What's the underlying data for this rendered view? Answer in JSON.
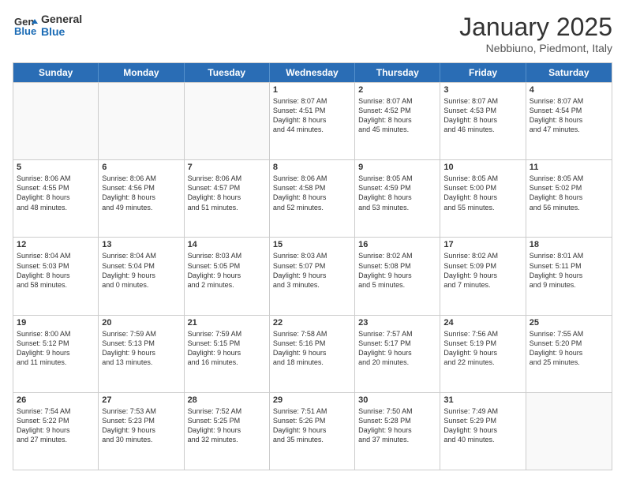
{
  "logo": {
    "line1": "General",
    "line2": "Blue"
  },
  "title": "January 2025",
  "subtitle": "Nebbiuno, Piedmont, Italy",
  "days": [
    "Sunday",
    "Monday",
    "Tuesday",
    "Wednesday",
    "Thursday",
    "Friday",
    "Saturday"
  ],
  "weeks": [
    [
      {
        "day": "",
        "empty": true
      },
      {
        "day": "",
        "empty": true
      },
      {
        "day": "",
        "empty": true
      },
      {
        "day": "1",
        "text": "Sunrise: 8:07 AM\nSunset: 4:51 PM\nDaylight: 8 hours\nand 44 minutes."
      },
      {
        "day": "2",
        "text": "Sunrise: 8:07 AM\nSunset: 4:52 PM\nDaylight: 8 hours\nand 45 minutes."
      },
      {
        "day": "3",
        "text": "Sunrise: 8:07 AM\nSunset: 4:53 PM\nDaylight: 8 hours\nand 46 minutes."
      },
      {
        "day": "4",
        "text": "Sunrise: 8:07 AM\nSunset: 4:54 PM\nDaylight: 8 hours\nand 47 minutes."
      }
    ],
    [
      {
        "day": "5",
        "text": "Sunrise: 8:06 AM\nSunset: 4:55 PM\nDaylight: 8 hours\nand 48 minutes."
      },
      {
        "day": "6",
        "text": "Sunrise: 8:06 AM\nSunset: 4:56 PM\nDaylight: 8 hours\nand 49 minutes."
      },
      {
        "day": "7",
        "text": "Sunrise: 8:06 AM\nSunset: 4:57 PM\nDaylight: 8 hours\nand 51 minutes."
      },
      {
        "day": "8",
        "text": "Sunrise: 8:06 AM\nSunset: 4:58 PM\nDaylight: 8 hours\nand 52 minutes."
      },
      {
        "day": "9",
        "text": "Sunrise: 8:05 AM\nSunset: 4:59 PM\nDaylight: 8 hours\nand 53 minutes."
      },
      {
        "day": "10",
        "text": "Sunrise: 8:05 AM\nSunset: 5:00 PM\nDaylight: 8 hours\nand 55 minutes."
      },
      {
        "day": "11",
        "text": "Sunrise: 8:05 AM\nSunset: 5:02 PM\nDaylight: 8 hours\nand 56 minutes."
      }
    ],
    [
      {
        "day": "12",
        "text": "Sunrise: 8:04 AM\nSunset: 5:03 PM\nDaylight: 8 hours\nand 58 minutes."
      },
      {
        "day": "13",
        "text": "Sunrise: 8:04 AM\nSunset: 5:04 PM\nDaylight: 9 hours\nand 0 minutes."
      },
      {
        "day": "14",
        "text": "Sunrise: 8:03 AM\nSunset: 5:05 PM\nDaylight: 9 hours\nand 2 minutes."
      },
      {
        "day": "15",
        "text": "Sunrise: 8:03 AM\nSunset: 5:07 PM\nDaylight: 9 hours\nand 3 minutes."
      },
      {
        "day": "16",
        "text": "Sunrise: 8:02 AM\nSunset: 5:08 PM\nDaylight: 9 hours\nand 5 minutes."
      },
      {
        "day": "17",
        "text": "Sunrise: 8:02 AM\nSunset: 5:09 PM\nDaylight: 9 hours\nand 7 minutes."
      },
      {
        "day": "18",
        "text": "Sunrise: 8:01 AM\nSunset: 5:11 PM\nDaylight: 9 hours\nand 9 minutes."
      }
    ],
    [
      {
        "day": "19",
        "text": "Sunrise: 8:00 AM\nSunset: 5:12 PM\nDaylight: 9 hours\nand 11 minutes."
      },
      {
        "day": "20",
        "text": "Sunrise: 7:59 AM\nSunset: 5:13 PM\nDaylight: 9 hours\nand 13 minutes."
      },
      {
        "day": "21",
        "text": "Sunrise: 7:59 AM\nSunset: 5:15 PM\nDaylight: 9 hours\nand 16 minutes."
      },
      {
        "day": "22",
        "text": "Sunrise: 7:58 AM\nSunset: 5:16 PM\nDaylight: 9 hours\nand 18 minutes."
      },
      {
        "day": "23",
        "text": "Sunrise: 7:57 AM\nSunset: 5:17 PM\nDaylight: 9 hours\nand 20 minutes."
      },
      {
        "day": "24",
        "text": "Sunrise: 7:56 AM\nSunset: 5:19 PM\nDaylight: 9 hours\nand 22 minutes."
      },
      {
        "day": "25",
        "text": "Sunrise: 7:55 AM\nSunset: 5:20 PM\nDaylight: 9 hours\nand 25 minutes."
      }
    ],
    [
      {
        "day": "26",
        "text": "Sunrise: 7:54 AM\nSunset: 5:22 PM\nDaylight: 9 hours\nand 27 minutes."
      },
      {
        "day": "27",
        "text": "Sunrise: 7:53 AM\nSunset: 5:23 PM\nDaylight: 9 hours\nand 30 minutes."
      },
      {
        "day": "28",
        "text": "Sunrise: 7:52 AM\nSunset: 5:25 PM\nDaylight: 9 hours\nand 32 minutes."
      },
      {
        "day": "29",
        "text": "Sunrise: 7:51 AM\nSunset: 5:26 PM\nDaylight: 9 hours\nand 35 minutes."
      },
      {
        "day": "30",
        "text": "Sunrise: 7:50 AM\nSunset: 5:28 PM\nDaylight: 9 hours\nand 37 minutes."
      },
      {
        "day": "31",
        "text": "Sunrise: 7:49 AM\nSunset: 5:29 PM\nDaylight: 9 hours\nand 40 minutes."
      },
      {
        "day": "",
        "empty": true
      }
    ]
  ]
}
